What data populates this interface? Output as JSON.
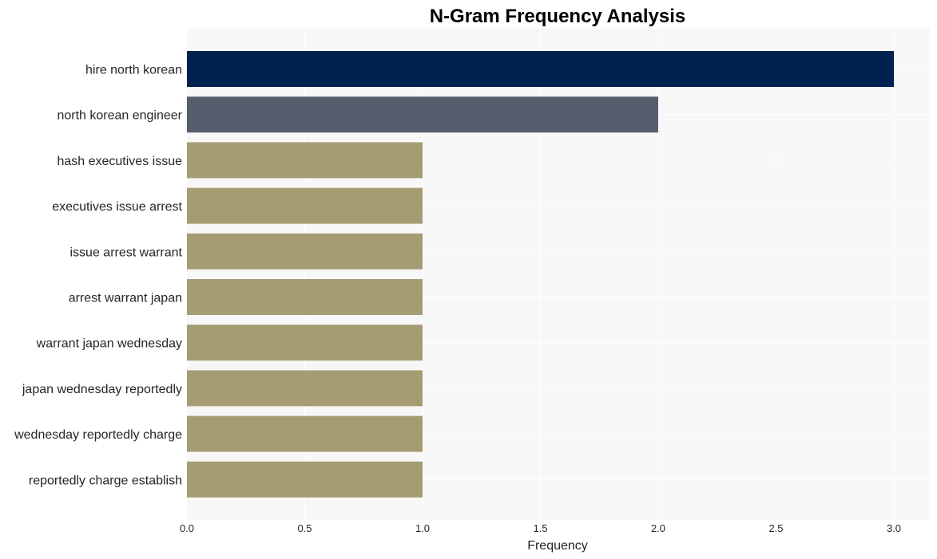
{
  "chart_data": {
    "type": "bar",
    "orientation": "horizontal",
    "title": "N-Gram Frequency Analysis",
    "xlabel": "Frequency",
    "ylabel": "",
    "xlim": [
      0,
      3.15
    ],
    "xticks": [
      0.0,
      0.5,
      1.0,
      1.5,
      2.0,
      2.5,
      3.0
    ],
    "xtick_labels": [
      "0.0",
      "0.5",
      "1.0",
      "1.5",
      "2.0",
      "2.5",
      "3.0"
    ],
    "grid": true,
    "categories": [
      "hire north korean",
      "north korean engineer",
      "hash executives issue",
      "executives issue arrest",
      "issue arrest warrant",
      "arrest warrant japan",
      "warrant japan wednesday",
      "japan wednesday reportedly",
      "wednesday reportedly charge",
      "reportedly charge establish"
    ],
    "values": [
      3,
      2,
      1,
      1,
      1,
      1,
      1,
      1,
      1,
      1
    ],
    "colors": [
      "#00224e",
      "#575d6d",
      "#a59c74",
      "#a59c74",
      "#a59c74",
      "#a59c74",
      "#a59c74",
      "#a59c74",
      "#a59c74",
      "#a59c74"
    ],
    "background": "#f7f7f7",
    "grid_color": "#ffffff"
  }
}
